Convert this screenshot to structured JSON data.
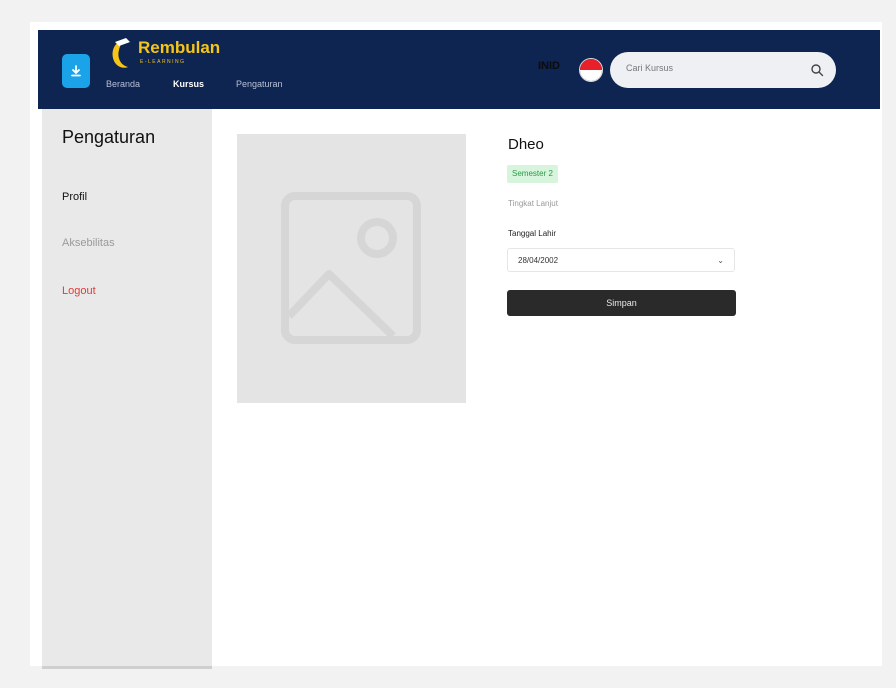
{
  "header": {
    "logo_text": "Rembulan",
    "logo_subtext": "E-LEARNING",
    "nav": [
      "Beranda",
      "Kursus",
      "Pengaturan"
    ],
    "active_nav": "Kursus",
    "language": "INID",
    "search_placeholder": "Cari Kursus",
    "colors": {
      "bar": "#0e2451",
      "brand": "#f5c518",
      "download": "#1aa3e8"
    }
  },
  "sidebar": {
    "title": "Pengaturan",
    "items": [
      "Profil",
      "Aksebilitas",
      "Logout"
    ],
    "colors": {
      "active": "#111111",
      "muted": "#9a9a9a",
      "danger": "#e53935"
    }
  },
  "profile": {
    "name": "Dheo",
    "semester": "Semester 2",
    "level": "Tingkat Lanjut",
    "dob_label": "Tanggal Lahir",
    "dob_value": "28/04/2002",
    "save_label": "Simpan"
  }
}
